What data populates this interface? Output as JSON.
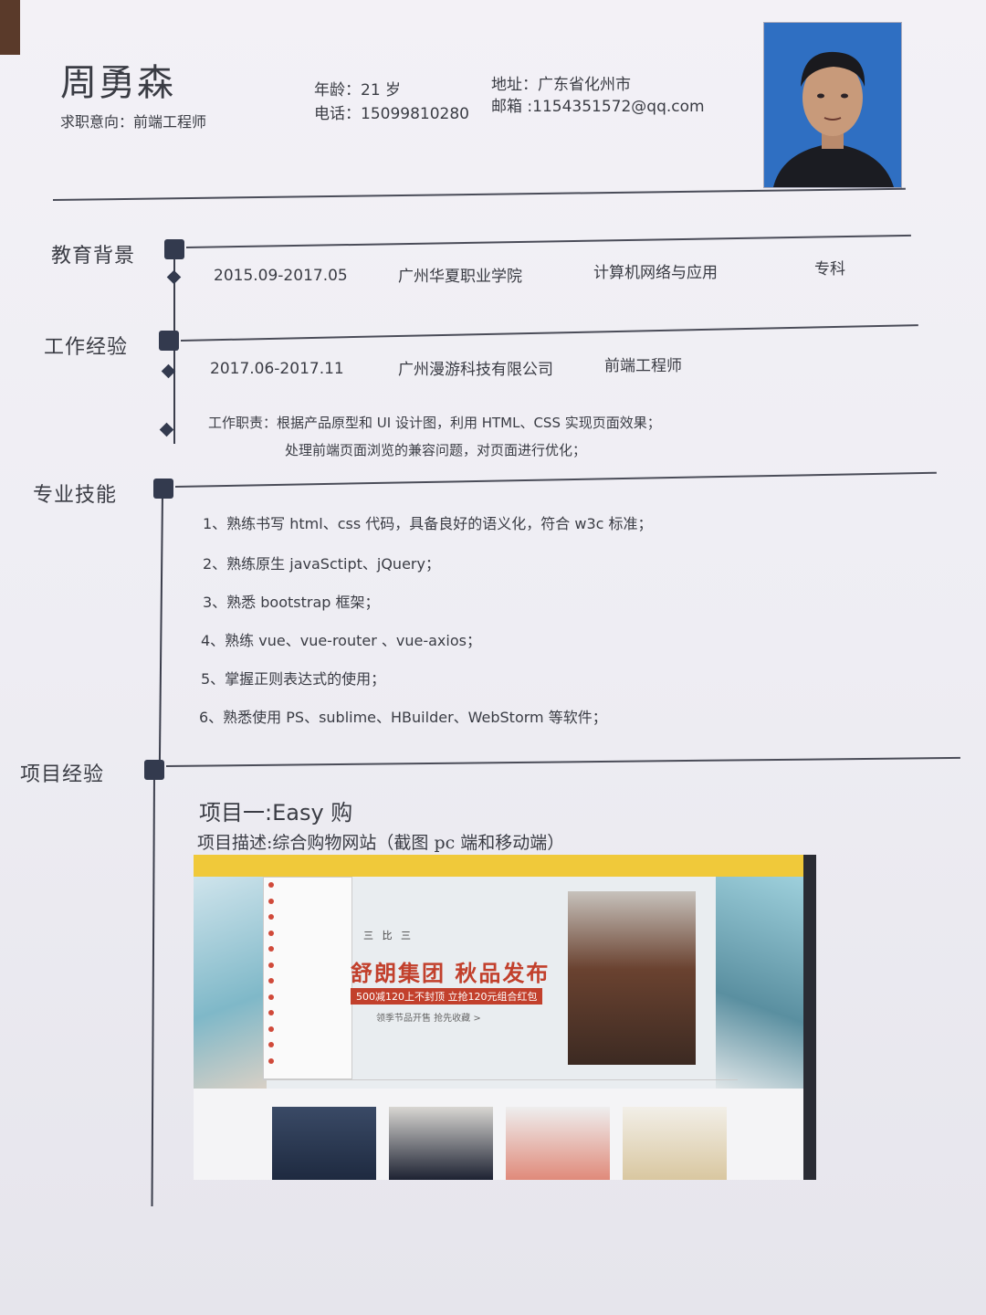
{
  "header": {
    "name": "周勇森",
    "intent_label": "求职意向：",
    "intent_value": "前端工程师",
    "age": "年龄：21 岁",
    "phone": "电话：15099810280",
    "address": "地址：广东省化州市",
    "email": "邮箱 :1154351572@qq.com"
  },
  "education": {
    "title": "教育背景",
    "period": "2015.09-2017.05",
    "school": "广州华夏职业学院",
    "major": "计算机网络与应用",
    "degree": "专科"
  },
  "work": {
    "title": "工作经验",
    "period": "2017.06-2017.11",
    "company": "广州漫游科技有限公司",
    "position": "前端工程师",
    "duty_line1": "工作职责：根据产品原型和  UI  设计图，利用  HTML、CSS  实现页面效果；",
    "duty_line2": "处理前端页面浏览的兼容问题，对页面进行优化；"
  },
  "skills": {
    "title": "专业技能",
    "items": [
      "1、熟练书写 html、css 代码，具备良好的语义化，符合 w3c 标准；",
      "2、熟练原生 javaSctipt、jQuery；",
      "3、熟悉 bootstrap 框架；",
      "4、熟练 vue、vue-router 、vue-axios；",
      "5、掌握正则表达式的使用；",
      "6、熟悉使用 PS、sublime、HBuilder、WebStorm 等软件；"
    ]
  },
  "projects": {
    "title": "项目经验",
    "project1_title": "项目一:Easy 购",
    "project1_desc": "项目描述:综合购物网站（截图 pc 端和移动端）",
    "screenshot": {
      "headline": "舒朗集团  秋品发布",
      "promo": "500减120上不封顶  立抢120元组合红包",
      "sub": "领季节品开售  抢先收藏 >",
      "brands": "三 比 三"
    }
  },
  "colors": {
    "ink": "#3a3c44",
    "marker": "#333a4e",
    "photo_bg": "#2f6fc2",
    "accent_yellow": "#f0c93a",
    "accent_red": "#c2402c"
  }
}
